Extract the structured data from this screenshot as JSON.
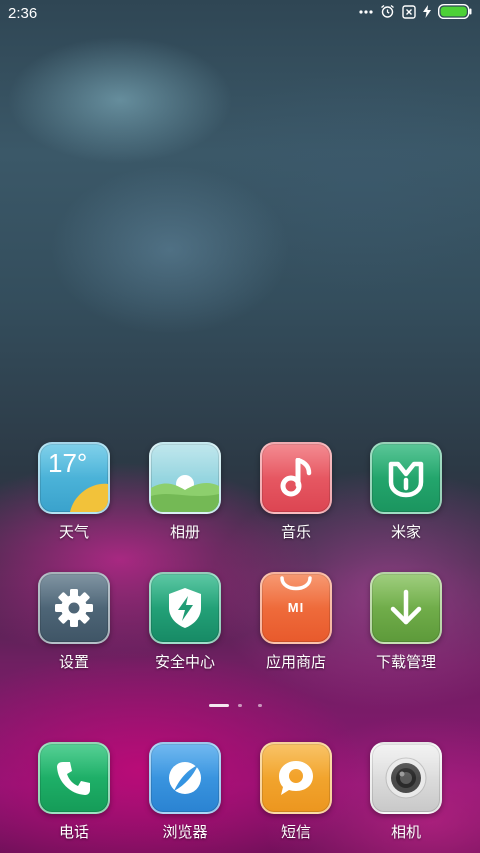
{
  "status_bar": {
    "time": "2:36",
    "icons": [
      "more-dots-icon",
      "alarm-clock-icon",
      "no-sim-icon",
      "charging-bolt-icon",
      "battery-icon"
    ],
    "battery_color": "#4cd137"
  },
  "home_grid": {
    "row1": [
      {
        "label": "天气",
        "icon": "weather-icon",
        "temperature": "17°"
      },
      {
        "label": "相册",
        "icon": "gallery-icon"
      },
      {
        "label": "音乐",
        "icon": "music-note-icon"
      },
      {
        "label": "米家",
        "icon": "mijia-icon"
      }
    ],
    "row2": [
      {
        "label": "设置",
        "icon": "gear-icon"
      },
      {
        "label": "安全中心",
        "icon": "shield-bolt-icon"
      },
      {
        "label": "应用商店",
        "icon": "shopping-bag-icon",
        "badge_text": "MI"
      },
      {
        "label": "下载管理",
        "icon": "download-arrow-icon"
      }
    ]
  },
  "page_indicator": {
    "pages": 3,
    "current": 1
  },
  "dock": [
    {
      "label": "电话",
      "icon": "phone-icon"
    },
    {
      "label": "浏览器",
      "icon": "browser-icon"
    },
    {
      "label": "短信",
      "icon": "message-bubble-icon"
    },
    {
      "label": "相机",
      "icon": "camera-icon"
    }
  ],
  "colors": {
    "weather": "#4fb4d8",
    "gallery": "#8dcf6d",
    "music": "#e8545d",
    "mijia": "#23a36b",
    "settings": "#4e6576",
    "security": "#21a07a",
    "app_store": "#f06a3c",
    "download": "#74b24a",
    "phone": "#20b36a",
    "browser": "#3494e2",
    "messages": "#f3a229",
    "camera": "#d8d8d8"
  }
}
